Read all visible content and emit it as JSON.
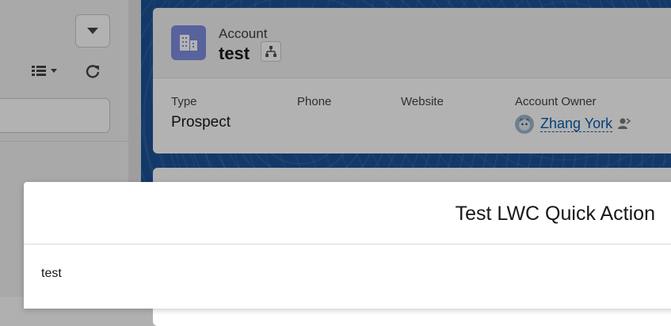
{
  "account": {
    "object_label": "Account",
    "name": "test",
    "fields": [
      {
        "label": "Type",
        "value": "Prospect"
      },
      {
        "label": "Phone",
        "value": ""
      },
      {
        "label": "Website",
        "value": ""
      },
      {
        "label": "Account Owner",
        "value": "Zhang York"
      }
    ]
  },
  "modal": {
    "title": "Test LWC Quick Action",
    "body": "test"
  },
  "icons": [
    "chevron-down-icon",
    "list-view-icon",
    "refresh-icon",
    "account-icon",
    "hierarchy-icon",
    "user-avatar-icon",
    "change-owner-icon"
  ],
  "colors": {
    "brand_blue": "#1b5297",
    "account_icon": "#7f8de1",
    "link": "#0b5cab"
  }
}
